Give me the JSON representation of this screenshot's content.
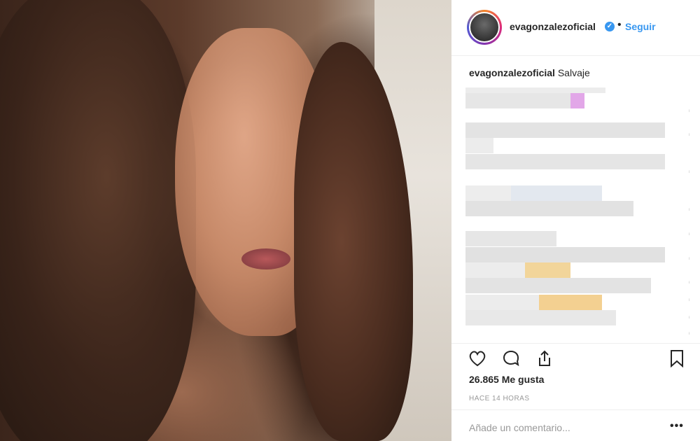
{
  "header": {
    "username": "evagonzalezoficial",
    "verified_mark": "✓",
    "separator": "•",
    "follow_label": "Seguir"
  },
  "caption": {
    "username": "evagonzalezoficial",
    "text": "Salvaje"
  },
  "actions": {
    "like_icon": "heart-icon",
    "comment_icon": "comment-icon",
    "share_icon": "share-icon",
    "save_icon": "bookmark-icon"
  },
  "likes": {
    "count_text": "26.865 Me gusta"
  },
  "timestamp": "HACE 14 HORAS",
  "comment_box": {
    "placeholder": "Añade un comentario...",
    "more_label": "•••"
  },
  "colors": {
    "link_blue": "#3897f0",
    "text": "#262626",
    "muted": "#999999"
  }
}
